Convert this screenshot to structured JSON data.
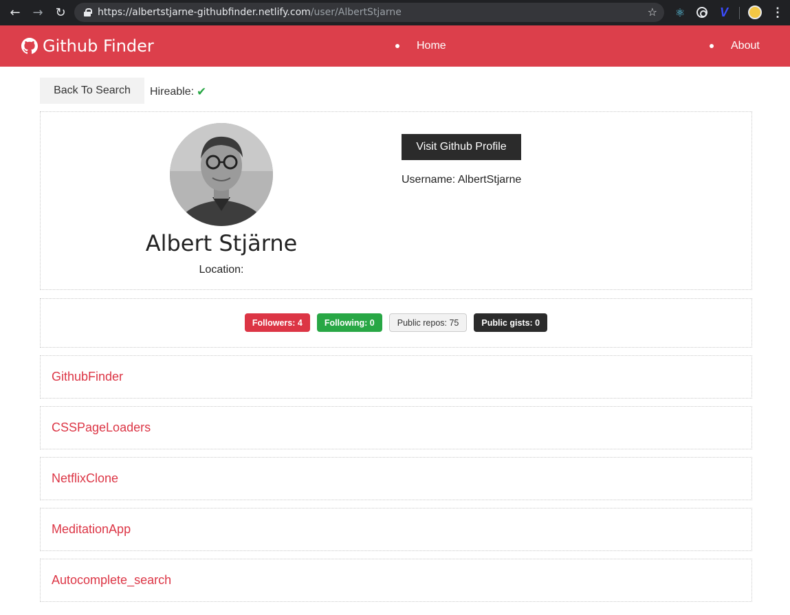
{
  "browser": {
    "url_host": "https://albertstjarne-githubfinder.netlify.com",
    "url_path": "/user/AlbertStjarne"
  },
  "navbar": {
    "brand": "Github Finder",
    "links": [
      "Home",
      "About"
    ],
    "background": "#dc3f4b"
  },
  "toolbar": {
    "back_label": "Back To Search",
    "hireable_label": "Hireable:",
    "hireable": true
  },
  "profile": {
    "name": "Albert Stjärne",
    "location_label": "Location:",
    "visit_label": "Visit Github Profile",
    "username_label": "Username: AlbertStjarne"
  },
  "stats": {
    "followers": "Followers: 4",
    "following": "Following: 0",
    "public_repos": "Public repos: 75",
    "public_gists": "Public gists: 0"
  },
  "repos": [
    "GithubFinder",
    "CSSPageLoaders",
    "NetflixClone",
    "MeditationApp",
    "Autocomplete_search"
  ],
  "colors": {
    "accent": "#dc3545",
    "success": "#28a745",
    "dark": "#2b2b2b"
  }
}
